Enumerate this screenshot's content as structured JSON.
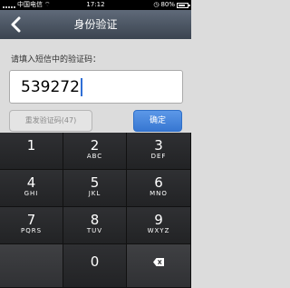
{
  "status_bar": {
    "carrier": "中国电信",
    "time": "17:12",
    "battery": "80%",
    "battery_level": 0.8
  },
  "nav": {
    "title": "身份验证"
  },
  "form": {
    "prompt": "请填入短信中的验证码：",
    "code_value": "539272",
    "resend_label": "重发验证码(47)",
    "confirm_label": "确定"
  },
  "keypad": {
    "keys": [
      {
        "num": "1",
        "letters": ""
      },
      {
        "num": "2",
        "letters": "ABC"
      },
      {
        "num": "3",
        "letters": "DEF"
      },
      {
        "num": "4",
        "letters": "GHI"
      },
      {
        "num": "5",
        "letters": "JKL"
      },
      {
        "num": "6",
        "letters": "MNO"
      },
      {
        "num": "7",
        "letters": "PQRS"
      },
      {
        "num": "8",
        "letters": "TUV"
      },
      {
        "num": "9",
        "letters": "WXYZ"
      },
      {
        "num": "0",
        "letters": ""
      }
    ]
  },
  "colors": {
    "nav_bg": "#4a5361",
    "confirm_bg": "#4a87dc",
    "keypad_bg": "#2a2b2e"
  },
  "icons": {
    "back": "chevron-left-icon",
    "delete": "backspace-icon"
  }
}
